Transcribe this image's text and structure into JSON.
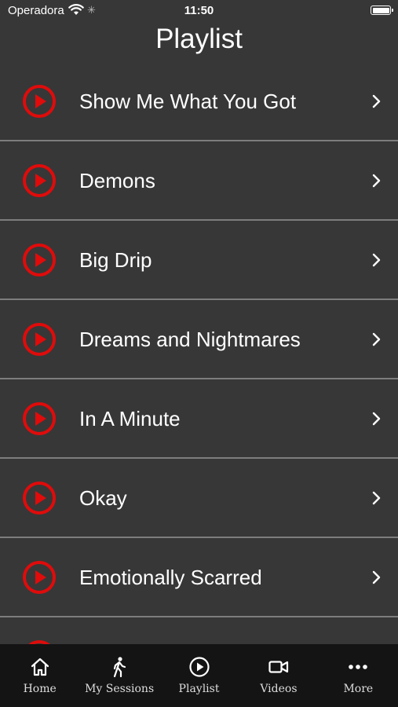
{
  "status_bar": {
    "carrier": "Operadora",
    "time": "11:50"
  },
  "header": {
    "title": "Playlist"
  },
  "playlist": {
    "items": [
      {
        "title": "Show Me What You Got"
      },
      {
        "title": "Demons"
      },
      {
        "title": "Big Drip"
      },
      {
        "title": "Dreams and Nightmares"
      },
      {
        "title": "In A Minute"
      },
      {
        "title": "Okay"
      },
      {
        "title": "Emotionally Scarred"
      },
      {
        "title": ""
      }
    ]
  },
  "tab_bar": {
    "items": [
      {
        "label": "Home",
        "icon": "home-icon"
      },
      {
        "label": "My Sessions",
        "icon": "walking-person-icon"
      },
      {
        "label": "Playlist",
        "icon": "play-circle-icon"
      },
      {
        "label": "Videos",
        "icon": "video-camera-icon"
      },
      {
        "label": "More",
        "icon": "more-dots-icon"
      }
    ]
  },
  "colors": {
    "accent": "#e00b0b",
    "background": "#373737",
    "tab_bar": "#141414",
    "divider": "#7d7d7d"
  }
}
